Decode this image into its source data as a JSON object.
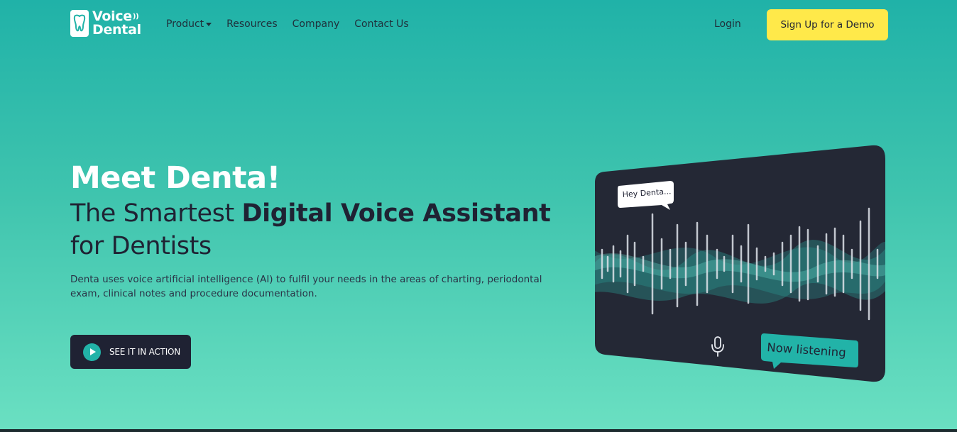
{
  "brand": {
    "line1": "Voice",
    "line2": "Dental",
    "wave_glyph": "))"
  },
  "nav": {
    "items": [
      {
        "label": "Product",
        "has_dropdown": true
      },
      {
        "label": "Resources",
        "has_dropdown": false
      },
      {
        "label": "Company",
        "has_dropdown": false
      },
      {
        "label": "Contact Us",
        "has_dropdown": false
      }
    ],
    "login": "Login",
    "demo_button": "Sign Up for a Demo"
  },
  "hero": {
    "title": "Meet Denta!",
    "subtitle_prefix": "The Smartest ",
    "subtitle_bold": "Digital Voice Assistant",
    "subtitle_suffix": "for Dentists",
    "description": "Denta uses voice artificial intelligence (AI) to fulfil your needs in the areas of charting, periodontal exam, clinical notes and procedure documentation.",
    "cta_label": "SEE IT IN ACTION"
  },
  "card": {
    "bubble_text": "Hey Denta...",
    "status_text": "Now listening",
    "icon": "microphone-icon"
  },
  "colors": {
    "accent_yellow": "#ffe94a",
    "dark_navy": "#1f2233",
    "teal": "#22b3a8",
    "card_bg": "#242835"
  }
}
